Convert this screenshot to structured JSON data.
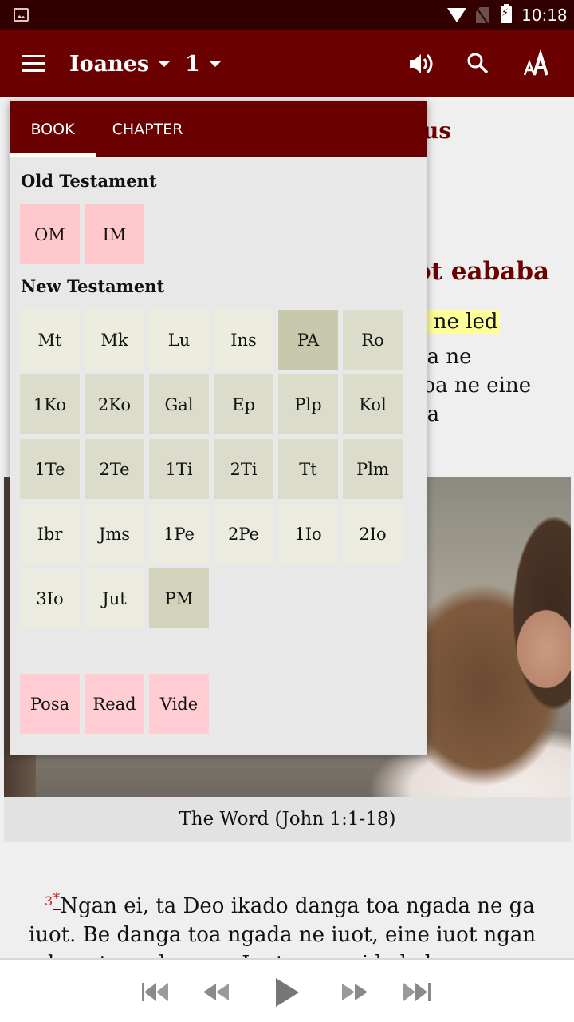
{
  "status_bar": {
    "time": "10:18",
    "icons": [
      "gallery-icon",
      "wifi-icon",
      "no-sim-icon",
      "battery-charging-icon"
    ]
  },
  "app_bar": {
    "book": "Ioanes",
    "chapter": "1",
    "actions": [
      "menu-icon",
      "speaker-icon",
      "search-icon",
      "text-size-icon"
    ]
  },
  "selector": {
    "tabs": [
      {
        "label": "BOOK",
        "active": true
      },
      {
        "label": "CHAPTER",
        "active": false
      }
    ],
    "old_testament": {
      "title": "Old Testament",
      "books": [
        "OM",
        "IM"
      ]
    },
    "new_testament": {
      "title": "New Testament",
      "books": [
        "Mt",
        "Mk",
        "Lu",
        "Ins",
        "PA",
        "Ro",
        "1Ko",
        "2Ko",
        "Gal",
        "Ep",
        "Plp",
        "Kol",
        "1Te",
        "2Te",
        "1Ti",
        "2Ti",
        "Tt",
        "Plm",
        "Ibr",
        "Jms",
        "1Pe",
        "2Pe",
        "1Io",
        "2Io",
        "3Io",
        "Jut",
        "PM"
      ],
      "highlighted": "PA"
    },
    "extras": [
      "Posa",
      "Read",
      "Vide"
    ]
  },
  "content": {
    "heading_fragment_1": "us",
    "heading_fragment_2": "ot eababa",
    "text_fragments": [
      "a ne led",
      "oa ne",
      "toa ne eine",
      "oa"
    ],
    "video_caption": "The Word (John 1:1-18)",
    "verse_number": "3",
    "footnote_marker": "*",
    "verse_text_line1": "Ngan ei, ta Deo ikado danga toa ngada ne ga",
    "verse_text_line2": "iuot. Be danga toa ngada ne iuot, eine iuot ngan",
    "verse_text_line3": "odon ete nada mea. Iuot ngan ei kekelen"
  },
  "player": {
    "controls": [
      "skip-to-start-icon",
      "rewind-icon",
      "play-icon",
      "fast-forward-icon",
      "skip-to-end-icon"
    ]
  },
  "colors": {
    "primary": "#6b0000",
    "status_bar": "#330000",
    "ot_tile": "#ffc8cc",
    "selected_tile": "#c8c8ac",
    "highlight": "#ffff99"
  }
}
